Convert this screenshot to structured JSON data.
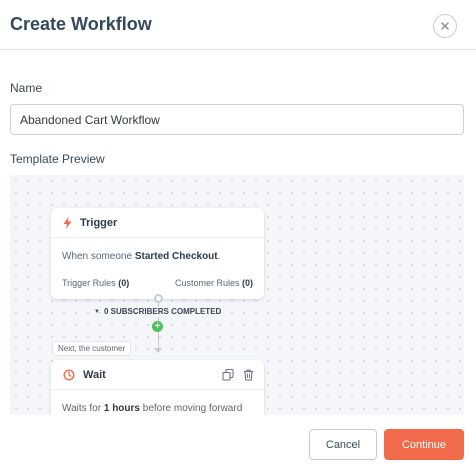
{
  "dialog": {
    "title": "Create Workflow",
    "close_icon": "close-icon"
  },
  "form": {
    "name_label": "Name",
    "name_value": "Abandoned Cart Workflow",
    "preview_label": "Template Preview"
  },
  "preview": {
    "trigger": {
      "icon": "lightning-icon",
      "title": "Trigger",
      "desc_prefix": "When someone ",
      "desc_event": "Started Checkout",
      "desc_suffix": ".",
      "trigger_rules_label": "Trigger Rules",
      "trigger_rules_count": "(0)",
      "customer_rules_label": "Customer Rules",
      "customer_rules_count": "(0)"
    },
    "subscribers_completed": "0 SUBSCRIBERS COMPLETED",
    "next_label": "Next, the customer",
    "wait": {
      "icon": "clock-icon",
      "title": "Wait",
      "desc_prefix": "Waits for ",
      "desc_duration": "1 hours",
      "desc_suffix": " before moving forward"
    }
  },
  "footer": {
    "cancel_label": "Cancel",
    "continue_label": "Continue"
  },
  "colors": {
    "accent": "#f06a4b",
    "success": "#4cc25e",
    "title": "#34495e"
  }
}
